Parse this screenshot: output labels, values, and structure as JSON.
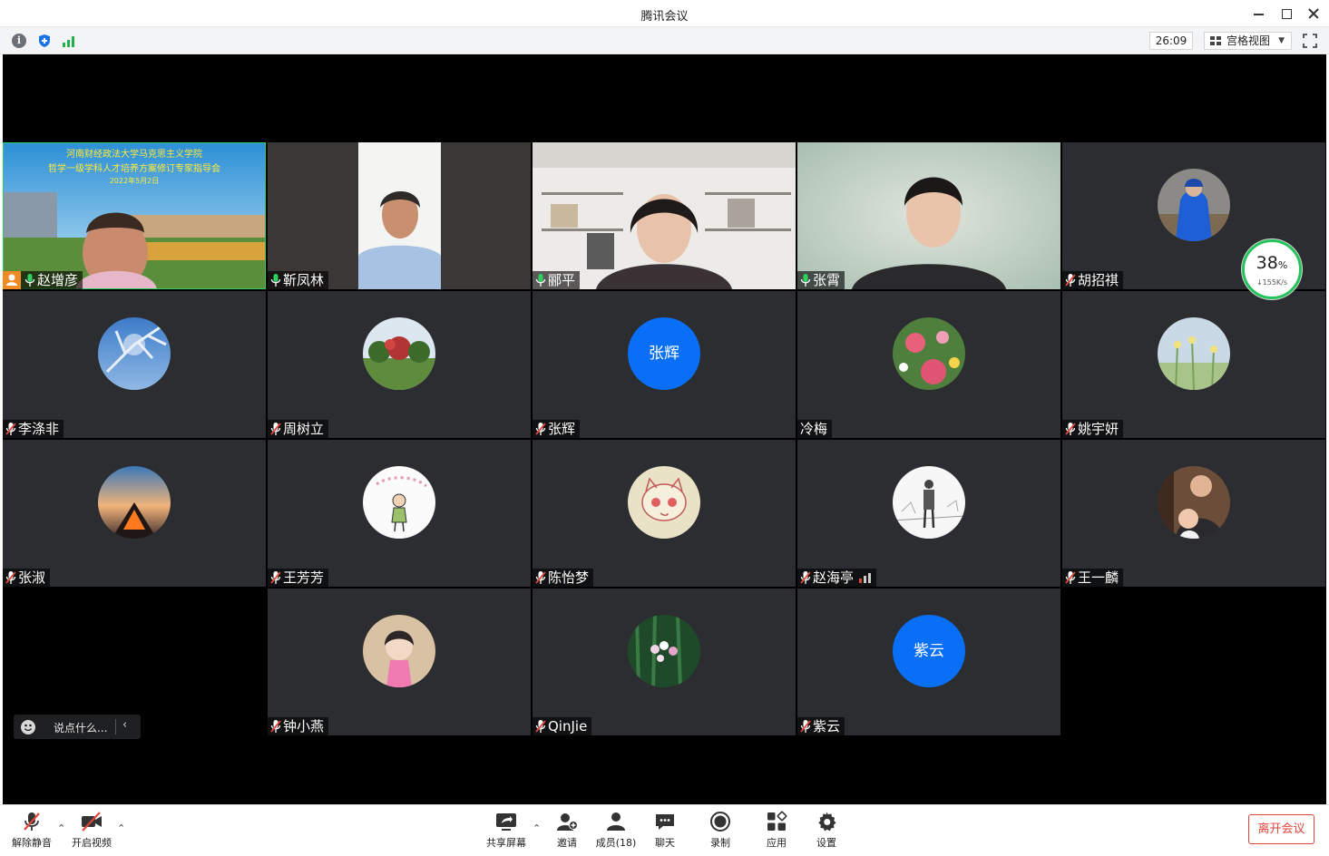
{
  "window": {
    "title": "腾讯会议"
  },
  "infobar": {
    "timer": "26:09",
    "view_mode": "宫格视图"
  },
  "network": {
    "percent": "38",
    "percent_unit": "%",
    "speed": "↓155K/s"
  },
  "chat": {
    "placeholder": "说点什么..."
  },
  "participants": [
    {
      "name": "赵增彦",
      "video": true,
      "mic": "on",
      "host": true,
      "active": true,
      "banner_line1": "河南财经政法大学马克思主义学院",
      "banner_line2": "哲学一级学科人才培养方案修订专家指导会",
      "banner_date": "2022年5月2日"
    },
    {
      "name": "靳凤林",
      "video": true,
      "mic": "on"
    },
    {
      "name": "郦平",
      "video": true,
      "mic": "on"
    },
    {
      "name": "张霄",
      "video": true,
      "mic": "on"
    },
    {
      "name": "胡招祺",
      "video": false,
      "mic": "muted",
      "avatar": "photo-child-blue"
    },
    {
      "name": "李涤非",
      "video": false,
      "mic": "muted",
      "avatar": "photo-tree-sky"
    },
    {
      "name": "周树立",
      "video": false,
      "mic": "muted",
      "avatar": "photo-garden"
    },
    {
      "name": "张辉",
      "video": false,
      "mic": "muted",
      "avatar_text": "张辉"
    },
    {
      "name": "冷梅",
      "video": false,
      "mic": "none",
      "avatar": "photo-flowers"
    },
    {
      "name": "姚宇妍",
      "video": false,
      "mic": "muted",
      "avatar": "photo-meadow"
    },
    {
      "name": "张淑",
      "video": false,
      "mic": "muted",
      "avatar": "photo-sunset"
    },
    {
      "name": "王芳芳",
      "video": false,
      "mic": "muted",
      "avatar": "drawing-girl"
    },
    {
      "name": "陈怡梦",
      "video": false,
      "mic": "muted",
      "avatar": "drawing-cat"
    },
    {
      "name": "赵海亭",
      "video": false,
      "mic": "muted",
      "avatar": "sketch-man",
      "signal": true
    },
    {
      "name": "王一麟",
      "video": false,
      "mic": "muted",
      "avatar": "photo-family"
    },
    {
      "name": "钟小燕",
      "video": false,
      "mic": "muted",
      "avatar": "cartoon-girl"
    },
    {
      "name": "QinJie",
      "video": false,
      "mic": "muted",
      "avatar": "photo-orchid"
    },
    {
      "name": "紫云",
      "video": false,
      "mic": "muted",
      "avatar_text": "紫云"
    }
  ],
  "toolbar": {
    "unmute": "解除静音",
    "start_video": "开启视频",
    "share_screen": "共享屏幕",
    "invite": "邀请",
    "members": "成员(18)",
    "chat": "聊天",
    "record": "录制",
    "apps": "应用",
    "settings": "设置",
    "leave": "离开会议"
  },
  "colors": {
    "accent": "#0a6ff7",
    "active_border": "#2fd15f",
    "leave": "#e0453a",
    "tile_bg": "#2b2d30"
  }
}
